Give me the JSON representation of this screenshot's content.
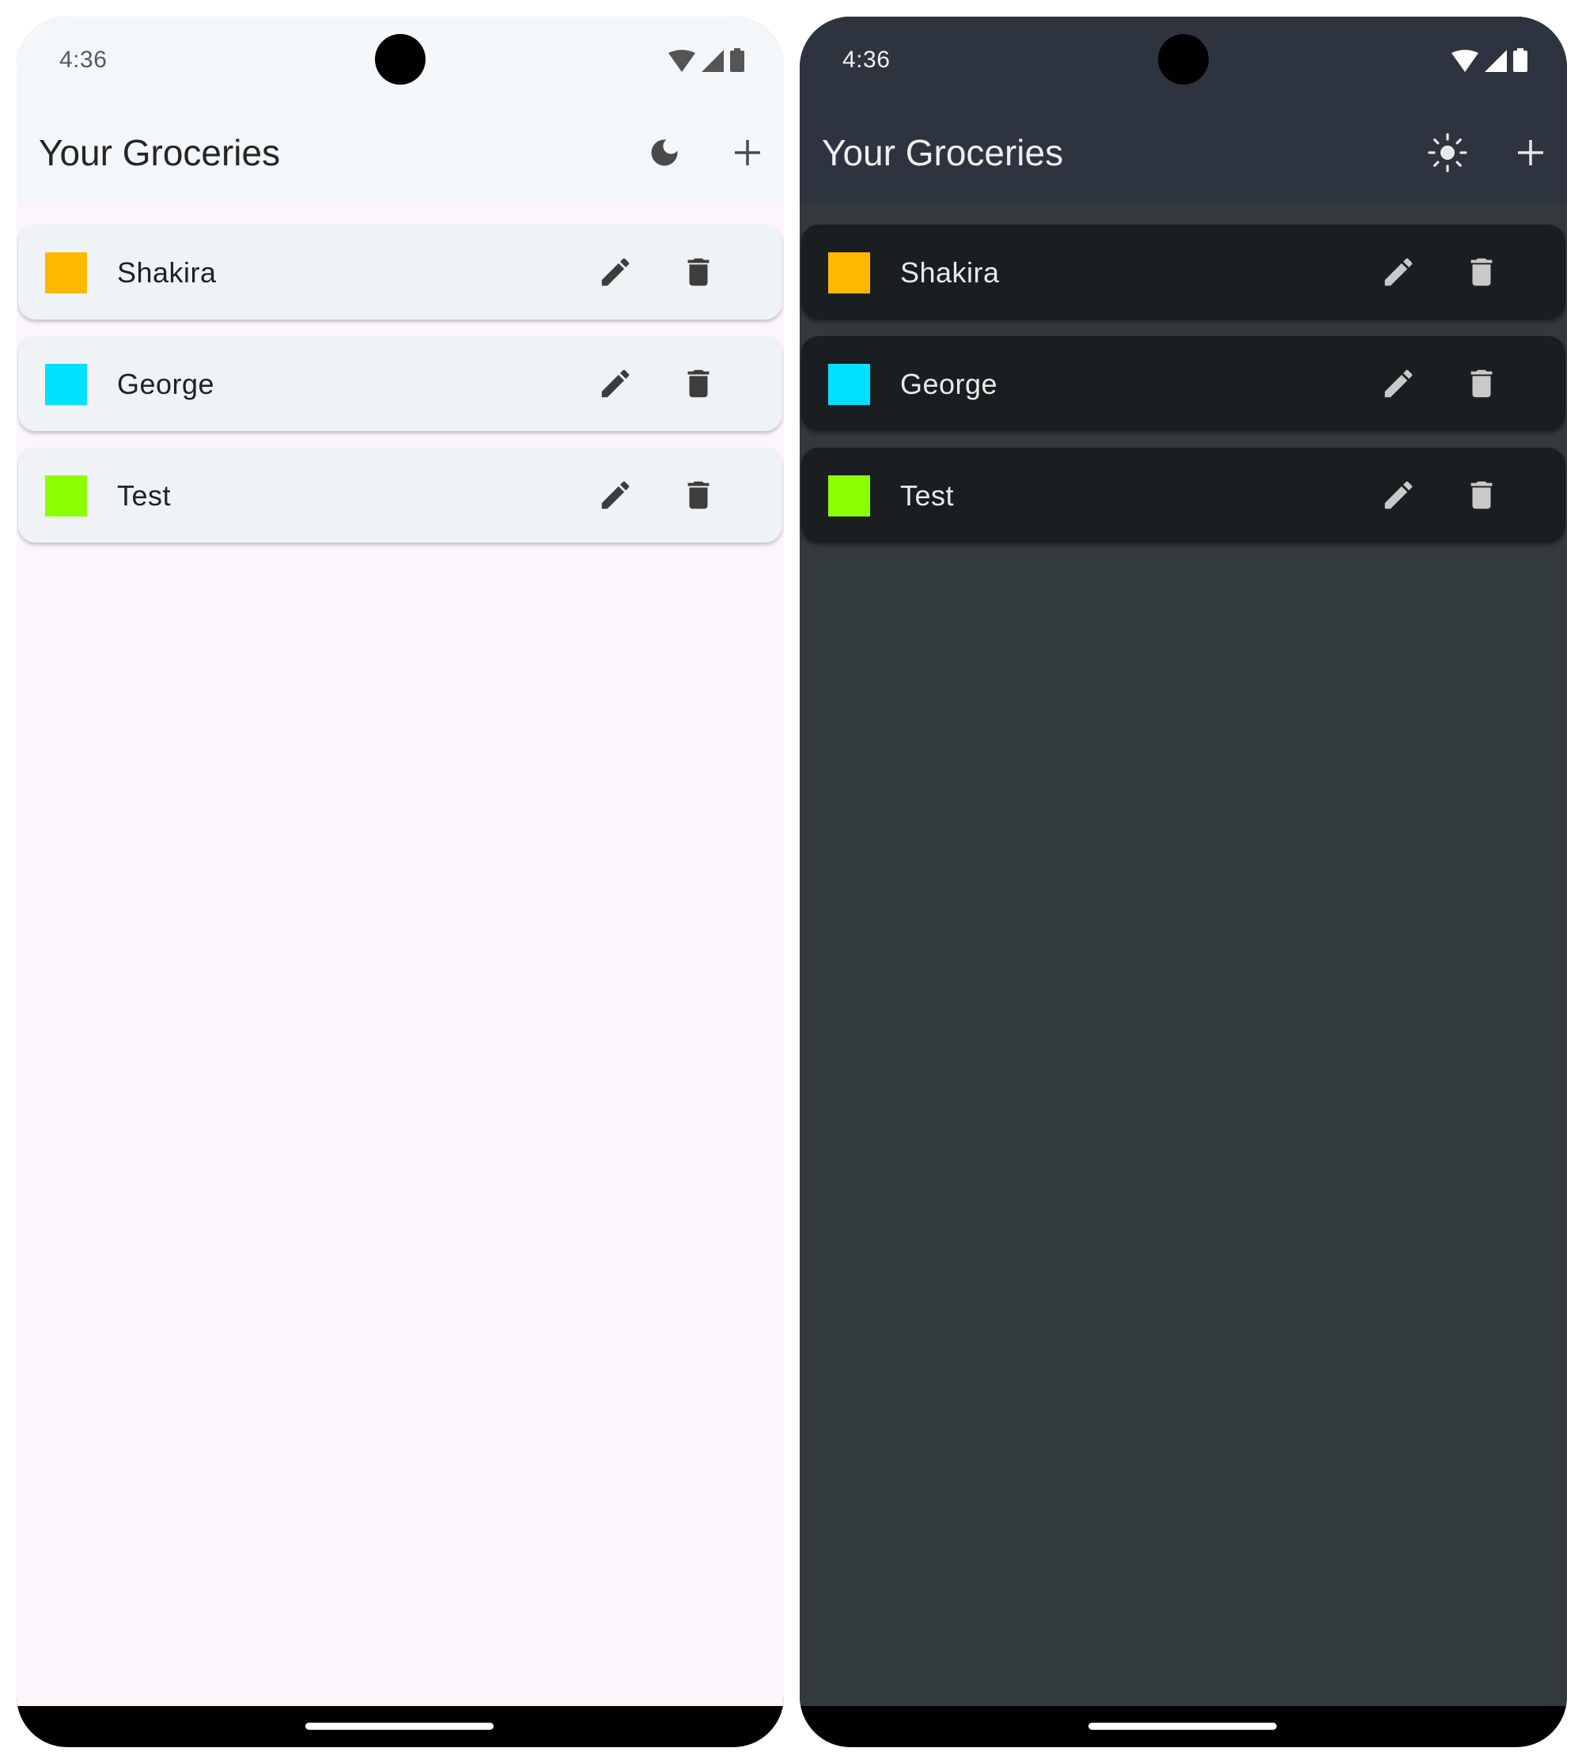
{
  "light": {
    "status": {
      "time": "4:36"
    },
    "header": {
      "title": "Your Groceries",
      "theme_toggle_icon": "moon-icon",
      "add_icon": "plus-icon"
    },
    "items": [
      {
        "name": "Shakira",
        "color": "#ffb800"
      },
      {
        "name": "George",
        "color": "#00e1ff"
      },
      {
        "name": "Test",
        "color": "#8cff00"
      }
    ]
  },
  "dark": {
    "status": {
      "time": "4:36"
    },
    "header": {
      "title": "Your Groceries",
      "theme_toggle_icon": "sun-icon",
      "add_icon": "plus-icon"
    },
    "items": [
      {
        "name": "Shakira",
        "color": "#ffb800"
      },
      {
        "name": "George",
        "color": "#00e1ff"
      },
      {
        "name": "Test",
        "color": "#8cff00"
      }
    ]
  }
}
